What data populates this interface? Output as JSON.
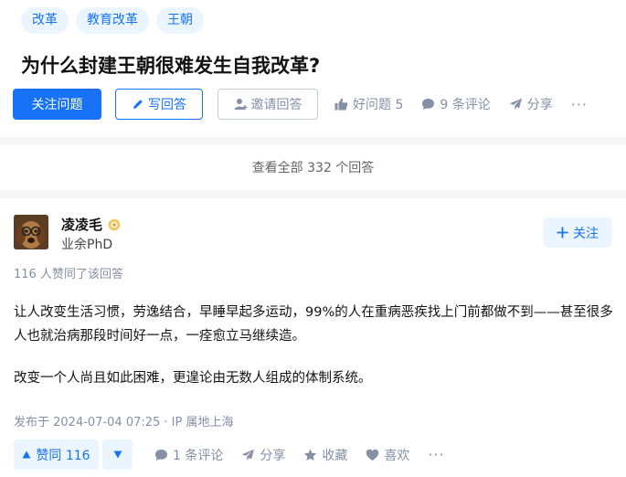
{
  "question": {
    "tags": [
      "改革",
      "教育改革",
      "王朝"
    ],
    "title": "为什么封建王朝很难发生自我改革?",
    "actions": {
      "follow_label": "关注问题",
      "write_label": "写回答",
      "invite_label": "邀请回答",
      "good_question_label": "好问题 5",
      "comments_label": "9 条评论",
      "share_label": "分享",
      "more_label": "···"
    }
  },
  "view_all_label": "查看全部 332 个回答",
  "answer": {
    "author": {
      "name": "凌凌毛",
      "headline": "业余PhD",
      "follow_label": "关注"
    },
    "vote_summary": "116 人赞同了该回答",
    "paragraphs": [
      "让人改变生活习惯，劳逸结合，早睡早起多运动，99%的人在重病恶疾找上门前都做不到——甚至很多人也就治病那段时间好一点，一痊愈立马继续造。",
      "改变一个人尚且如此困难，更遑论由无数人组成的体制系统。"
    ],
    "meta": "发布于 2024-07-04 07:25 · IP 属地上海",
    "actions": {
      "upvote_label": "赞同 116",
      "comments_label": "1 条评论",
      "share_label": "分享",
      "collect_label": "收藏",
      "like_label": "喜欢",
      "more_label": "···"
    }
  },
  "colors": {
    "brand_blue": "#1772f6",
    "light_blue_bg": "#ebf5ff",
    "muted_text": "#8590a6"
  }
}
